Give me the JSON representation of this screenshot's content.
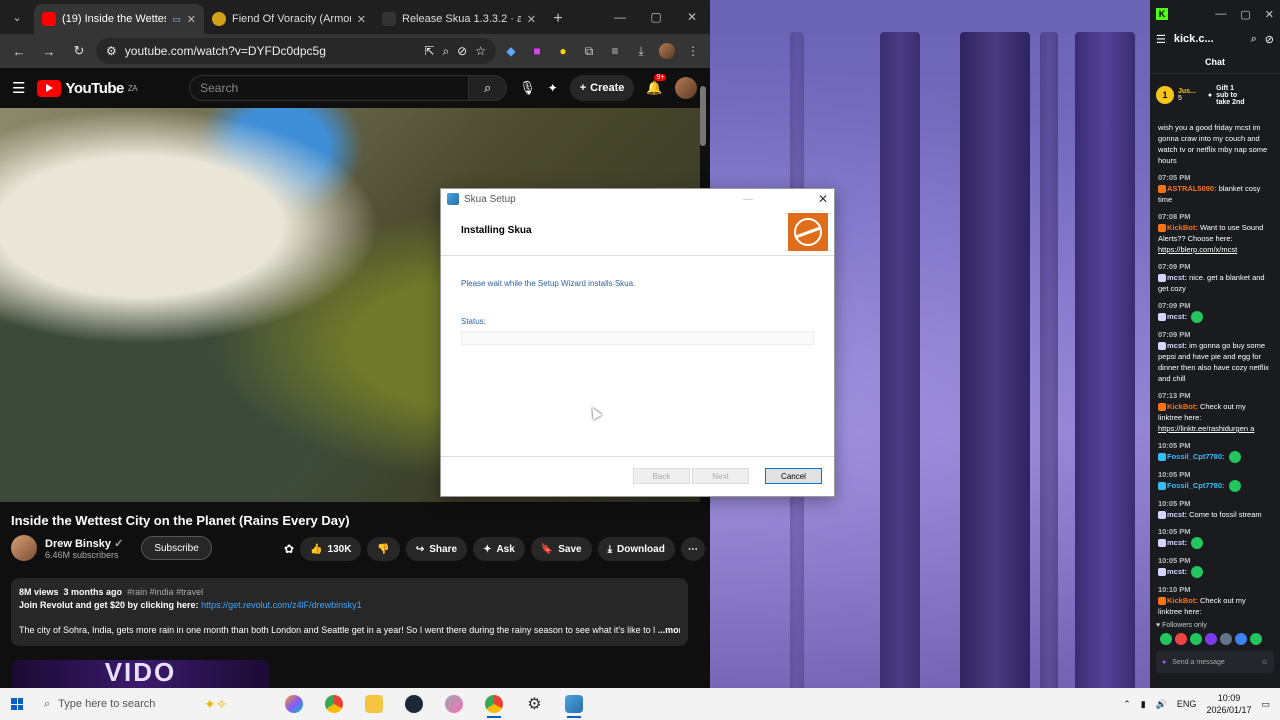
{
  "browser": {
    "tabs": [
      {
        "title": "(19) Inside the Wettest",
        "favicon_color": "#ff0000",
        "active": true
      },
      {
        "title": "Fiend Of Voracity (Armor)",
        "favicon_color": "#d4a018",
        "active": false
      },
      {
        "title": "Release Skua 1.3.3.2 · auq",
        "favicon_color": "#333333",
        "active": false
      }
    ],
    "url": "youtube.com/watch?v=DYFDc0dpc5g"
  },
  "youtube": {
    "logo_text": "YouTube",
    "region": "ZA",
    "search_placeholder": "Search",
    "create_label": "Create",
    "notification_count": "9+",
    "video_title": "Inside the Wettest City on the Planet (Rains Every Day)",
    "channel_name": "Drew Binsky",
    "subscribers": "6.46M subscribers",
    "subscribe_label": "Subscribe",
    "like_count": "130K",
    "share_label": "Share",
    "ask_label": "Ask",
    "save_label": "Save",
    "download_label": "Download",
    "views": "8M views",
    "age": "3 months ago",
    "tags": "#rain #india #travel",
    "promo_text": "Join Revolut and get $20 by clicking here:",
    "promo_link": "https://get.revolut.com/z4lF/drewbinsky1",
    "description": "The city of Sohra, India, gets more rain in one month than both London and Seattle get in a year! So I went there during the rainy season to see what it's like to l",
    "more_label": "...more",
    "next_thumb_text": "VIDO"
  },
  "dialog": {
    "window_title": "Skua Setup",
    "heading": "Installing Skua",
    "body": "Please wait while the Setup Wizard installs Skua.",
    "status_label": "Status:",
    "progress": 0,
    "back_label": "Back",
    "next_label": "Next",
    "cancel_label": "Cancel"
  },
  "kick": {
    "window_title": "kick.c...",
    "chat_title": "Chat",
    "pinned": {
      "user": "Jus...",
      "count": "5",
      "gift_text": "Gift 1 sub to take 2nd"
    },
    "messages": [
      {
        "time": "",
        "user": "",
        "user_color": "#f97316",
        "text": "wish you a good friday mcst im gonna craw into my couch and watch tv or netflix mby nap some hours"
      },
      {
        "time": "07:05 PM",
        "user": "ASTRAL5090:",
        "user_color": "#f97316",
        "text": "blanket cosy time"
      },
      {
        "time": "07:08 PM",
        "user": "KickBot:",
        "user_color": "#f97316",
        "text": "Want to use Sound Alerts?? Choose here:",
        "link": "https://blerp.com/x/mcst"
      },
      {
        "time": "07:09 PM",
        "user": "mcst:",
        "user_color": "#d4d4ff",
        "text": "nice. get a blanket and get cozy"
      },
      {
        "time": "07:09 PM",
        "user": "mcst:",
        "user_color": "#d4d4ff",
        "text": ""
      },
      {
        "time": "07:09 PM",
        "user": "mcst:",
        "user_color": "#d4d4ff",
        "text": "im gonna go buy some pepsi and have pie and egg for dinner then also have cozy netflix and chill"
      },
      {
        "time": "07:13 PM",
        "user": "KickBot:",
        "user_color": "#f97316",
        "text": "Check out my linktree here:",
        "link": "https://linktr.ee/rashidurgen a"
      },
      {
        "time": "10:05 PM",
        "user": "Fossil_Cpt7780:",
        "user_color": "#38bdf8",
        "text": ""
      },
      {
        "time": "10:05 PM",
        "user": "Fossil_Cpt7780:",
        "user_color": "#38bdf8",
        "text": ""
      },
      {
        "time": "10:05 PM",
        "user": "mcst:",
        "user_color": "#d4d4ff",
        "text": "Come to fossil stream"
      },
      {
        "time": "10:05 PM",
        "user": "mcst:",
        "user_color": "#d4d4ff",
        "text": ""
      },
      {
        "time": "10:05 PM",
        "user": "mcst:",
        "user_color": "#d4d4ff",
        "text": ""
      },
      {
        "time": "10:10 PM",
        "user": "KickBot:",
        "user_color": "#f97316",
        "text": "Check out my linktree here:",
        "link": "https://linktr.ee/rashidurgen a"
      }
    ],
    "followers_only": "Followers only",
    "send_placeholder": "Send a message"
  },
  "taskbar": {
    "search_placeholder": "Type here to search",
    "language": "ENG",
    "time": "10:09",
    "date": "2026/01/17"
  },
  "colors": {
    "accent": "#0078d7",
    "kick_green": "#53fc18",
    "yt_red": "#ff0000"
  }
}
